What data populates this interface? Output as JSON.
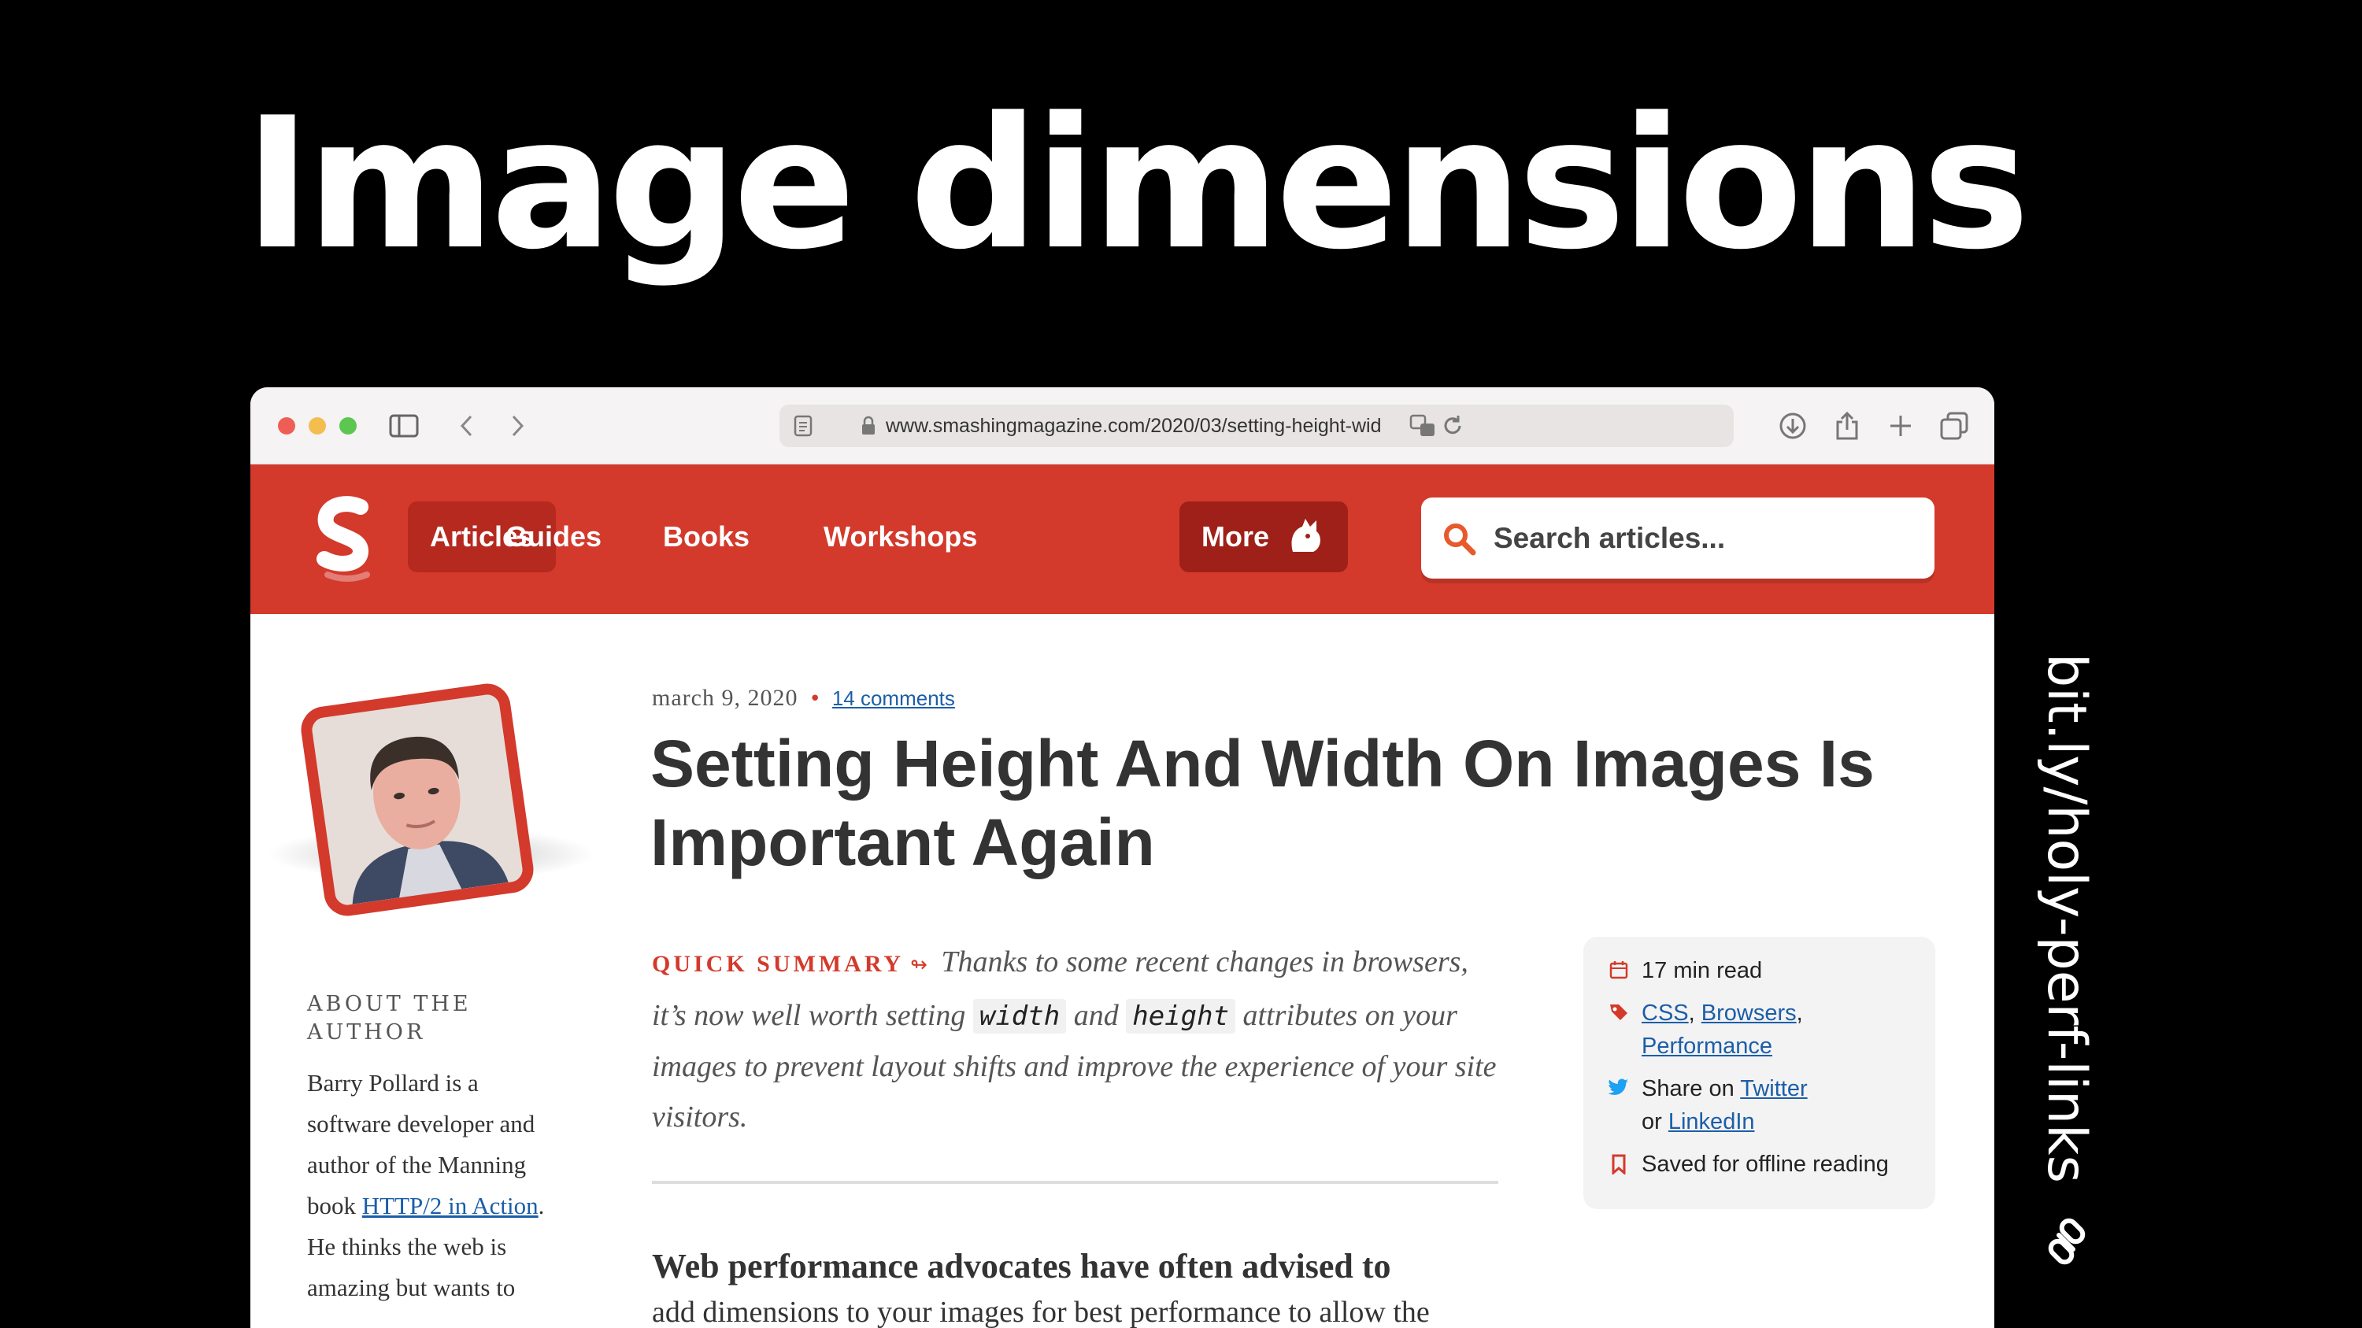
{
  "slide": {
    "title": "Image dimensions",
    "side_link": "bit.ly/holy-perf-links"
  },
  "browser": {
    "url": "www.smashingmagazine.com/2020/03/setting-height-wid"
  },
  "site": {
    "nav": [
      {
        "label": "Articles"
      },
      {
        "label": "Guides"
      },
      {
        "label": "Books"
      },
      {
        "label": "Workshops"
      },
      {
        "label": "More"
      }
    ],
    "search_placeholder": "Search articles..."
  },
  "article": {
    "date": "march 9, 2020",
    "comments": "14 comments",
    "title": "Setting Height And Width On Images Is Important Again",
    "summary_label": "QUICK SUMMARY",
    "summary_part1": "Thanks to some recent changes in browsers, it’s now well worth setting",
    "code_width": "width",
    "summary_and": "and",
    "code_height": "height",
    "summary_part2": "attributes on your images to prevent layout shifts and improve the experience of your site visitors.",
    "body_lead": "Web performance advocates have often advised to",
    "body_next": "add dimensions to your images for best performance to allow the"
  },
  "author": {
    "label": "ABOUT THE AUTHOR",
    "bio_part1": "Barry Pollard is a software developer and author of the Manning book",
    "bio_link": "HTTP/2 in Action",
    "bio_part2": ". He thinks the web is amazing but wants to"
  },
  "info_box": {
    "read_time": "17 min read",
    "tag_css": "CSS",
    "tag_browsers": "Browsers",
    "tag_performance": "Performance",
    "share_on": "Share on",
    "twitter": "Twitter",
    "or": "or",
    "linkedin": "LinkedIn",
    "saved": "Saved for offline reading"
  },
  "colors": {
    "brand": "#d33a2c",
    "link": "#1b5ea8",
    "background": "#000000"
  }
}
